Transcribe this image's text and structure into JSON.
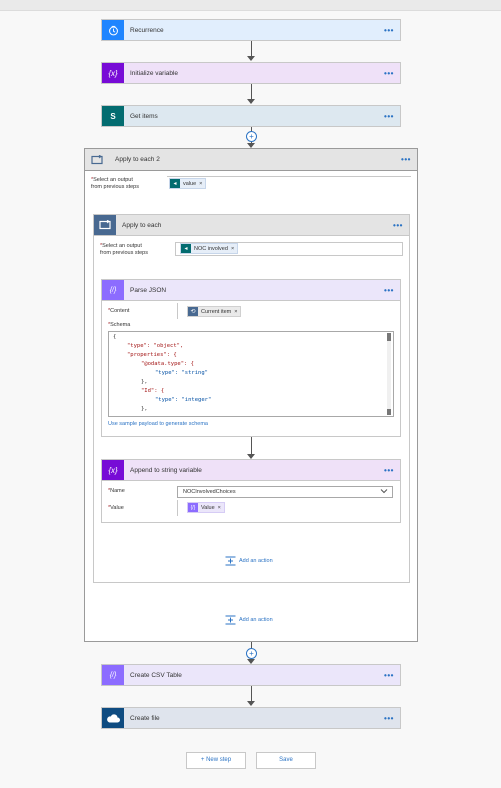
{
  "steps": {
    "recurrence": {
      "title": "Recurrence"
    },
    "init_var": {
      "title": "Initialize variable"
    },
    "get_items": {
      "title": "Get items"
    },
    "apply_each_2": {
      "title": "Apply to each 2",
      "select_label_1": "Select an output",
      "select_label_2": "from previous steps",
      "token": "value"
    },
    "apply_each": {
      "title": "Apply to each",
      "select_label_1": "Select an output",
      "select_label_2": "from previous steps",
      "token": "NOC involved"
    },
    "parse_json": {
      "title": "Parse JSON",
      "content_label": "Content",
      "content_token": "Current item",
      "schema_label": "Schema",
      "schema_lines": [
        "{",
        "\"type\": \"object\",",
        "\"properties\": {",
        "\"@odata.type\": {",
        "\"type\": \"string\"",
        "},",
        "\"Id\": {",
        "\"type\": \"integer\"",
        "},"
      ],
      "sample_link": "Use sample payload to generate schema"
    },
    "append_var": {
      "title": "Append to string variable",
      "name_label": "Name",
      "name_value": "NOCInvolvedChoices",
      "value_label": "Value",
      "value_token": "Value"
    },
    "csv": {
      "title": "Create CSV Table"
    },
    "create_file": {
      "title": "Create file"
    }
  },
  "add_action_inner": "Add an action",
  "add_action_outer": "Add an action",
  "buttons": {
    "new_step": "+ New step",
    "save": "Save"
  },
  "colors": {
    "recurrence": "#1f85ff",
    "variable": "#770bd6",
    "sharepoint": "#036c70",
    "control": "#486991",
    "data_ops": "#8c6cff",
    "onedrive": "#0f4c81",
    "accent": "#2b73c4"
  }
}
